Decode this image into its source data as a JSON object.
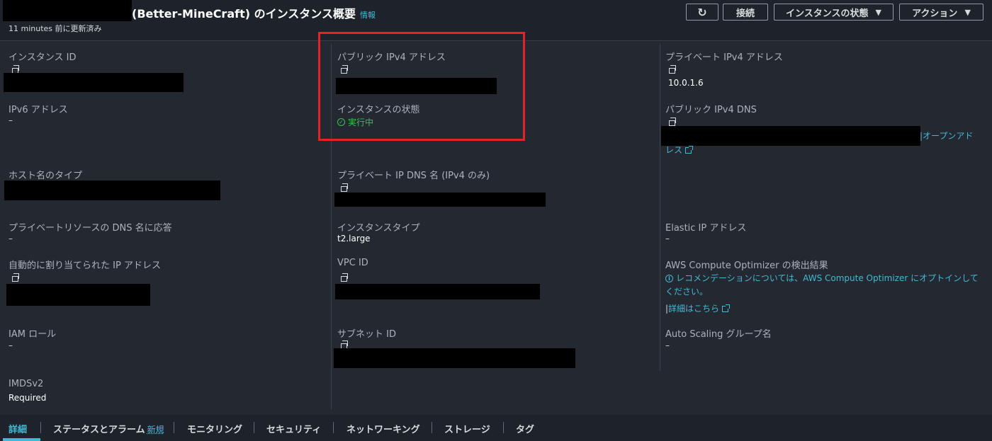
{
  "header": {
    "title": "(Better-MineCraft) のインスタンス概要",
    "info_link": "情報",
    "updated": "11 minutes 前に更新済み",
    "buttons": {
      "connect": "接続",
      "instance_state": "インスタンスの状態",
      "actions": "アクション"
    }
  },
  "fields": {
    "instance_id": {
      "label": "インスタンス ID"
    },
    "public_ipv4": {
      "label": "パブリック IPv4 アドレス"
    },
    "private_ipv4": {
      "label": "プライベート IPv4 アドレス",
      "value": "10.0.1.6"
    },
    "ipv6": {
      "label": "IPv6 アドレス",
      "value": "–"
    },
    "instance_state": {
      "label": "インスタンスの状態",
      "value": "実行中"
    },
    "public_dns": {
      "label": "パブリック IPv4 DNS",
      "link_part1": "|オープンアド",
      "link_part2": "レス"
    },
    "hostname_type": {
      "label": "ホスト名のタイプ"
    },
    "private_dns": {
      "label": "プライベート IP DNS 名 (IPv4 のみ)"
    },
    "private_resource_dns": {
      "label": "プライベートリソースの DNS 名に応答",
      "value": "–"
    },
    "instance_type": {
      "label": "インスタンスタイプ",
      "value": "t2.large"
    },
    "elastic_ip": {
      "label": "Elastic IP アドレス",
      "value": "–"
    },
    "auto_ip": {
      "label": "自動的に割り当てられた IP アドレス"
    },
    "vpc_id": {
      "label": "VPC ID"
    },
    "optimizer": {
      "label": "AWS Compute Optimizer の検出結果",
      "text_pre": "レコメンデーションについては、",
      "text_link": "AWS Compute Optimizer",
      "text_post": " にオプトインしてください。",
      "details_link": "詳細はこちら"
    },
    "iam_role": {
      "label": "IAM ロール",
      "value": "–"
    },
    "subnet_id": {
      "label": "サブネット ID"
    },
    "auto_scaling": {
      "label": "Auto Scaling グループ名",
      "value": "–"
    },
    "imdsv2": {
      "label": "IMDSv2",
      "value": "Required"
    }
  },
  "tabs": [
    {
      "label": "詳細",
      "active": true
    },
    {
      "label": "ステータスとアラーム",
      "badge": "新規"
    },
    {
      "label": "モニタリング"
    },
    {
      "label": "セキュリティ"
    },
    {
      "label": "ネットワーキング"
    },
    {
      "label": "ストレージ"
    },
    {
      "label": "タグ"
    }
  ],
  "colors": {
    "background": "#232831",
    "accent": "#44b9d6",
    "success": "#3fc04f",
    "highlight": "#e4222c"
  }
}
